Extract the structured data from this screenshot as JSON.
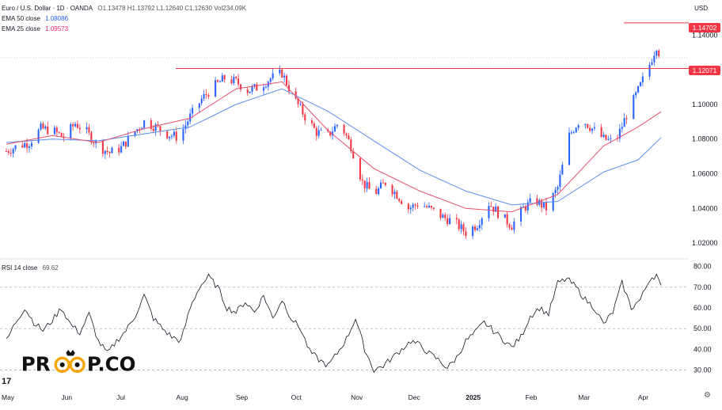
{
  "header": {
    "symbol_title": "Euro / U.S. Dollar · 1D · OANDA",
    "ohlc": "O1.13478 H1.13792 L1.12640 C1.12630 Vol234.09K",
    "ema50_label": "EMA 50 close",
    "ema50_value": "1.08086",
    "ema25_label": "EMA 25 close",
    "ema25_value": "1.09573",
    "currency": "USD"
  },
  "rsi_header": {
    "label": "RSI 14 close",
    "value": "69.62"
  },
  "price_labels": {
    "upper": "1.14702",
    "lower": "1.12071"
  },
  "logo": {
    "text_left": "PR",
    "text_right": "P.CO",
    "tv": "17"
  },
  "colors": {
    "up": "#2962ff",
    "down": "#f23645",
    "ema50": "#5b8def",
    "ema25": "#e8506b",
    "rsi": "#131722",
    "hline": "#f23645",
    "grid": "#d8d8d8"
  },
  "chart_data": [
    {
      "type": "candlestick",
      "title": "Euro / U.S. Dollar · 1D · OANDA",
      "x_ticks": [
        "May",
        "Jun",
        "Jul",
        "Aug",
        "Sep",
        "Oct",
        "Nov",
        "Dec",
        "2025",
        "Feb",
        "Mar",
        "Apr"
      ],
      "y_ticks": [
        "1.02000",
        "1.04000",
        "1.06000",
        "1.08000",
        "1.10000",
        "1.14000"
      ],
      "ylim": [
        1.015,
        1.152
      ],
      "horizontal_lines": [
        1.14702,
        1.12071
      ],
      "close_path": [
        [
          0,
          1.073
        ],
        [
          5,
          1.076
        ],
        [
          10,
          1.078
        ],
        [
          15,
          1.086
        ],
        [
          20,
          1.085
        ],
        [
          25,
          1.081
        ],
        [
          30,
          1.089
        ],
        [
          35,
          1.084
        ],
        [
          40,
          1.076
        ],
        [
          45,
          1.072
        ],
        [
          50,
          1.075
        ],
        [
          55,
          1.083
        ],
        [
          60,
          1.09
        ],
        [
          65,
          1.087
        ],
        [
          70,
          1.083
        ],
        [
          75,
          1.081
        ],
        [
          80,
          1.093
        ],
        [
          85,
          1.103
        ],
        [
          90,
          1.11
        ],
        [
          95,
          1.115
        ],
        [
          100,
          1.113
        ],
        [
          105,
          1.108
        ],
        [
          110,
          1.11
        ],
        [
          115,
          1.115
        ],
        [
          120,
          1.118
        ],
        [
          125,
          1.104
        ],
        [
          130,
          1.093
        ],
        [
          135,
          1.084
        ],
        [
          140,
          1.082
        ],
        [
          145,
          1.09
        ],
        [
          150,
          1.076
        ],
        [
          155,
          1.055
        ],
        [
          160,
          1.048
        ],
        [
          165,
          1.055
        ],
        [
          170,
          1.048
        ],
        [
          175,
          1.04
        ],
        [
          180,
          1.043
        ],
        [
          185,
          1.039
        ],
        [
          190,
          1.035
        ],
        [
          195,
          1.032
        ],
        [
          200,
          1.026
        ],
        [
          205,
          1.031
        ],
        [
          210,
          1.043
        ],
        [
          215,
          1.036
        ],
        [
          220,
          1.03
        ],
        [
          225,
          1.04
        ],
        [
          230,
          1.045
        ],
        [
          235,
          1.04
        ],
        [
          240,
          1.052
        ],
        [
          245,
          1.082
        ],
        [
          250,
          1.092
        ],
        [
          255,
          1.086
        ],
        [
          260,
          1.08
        ],
        [
          265,
          1.078
        ],
        [
          270,
          1.094
        ],
        [
          275,
          1.108
        ],
        [
          280,
          1.123
        ],
        [
          283,
          1.134
        ],
        [
          285,
          1.1263
        ]
      ],
      "ema50": [
        [
          0,
          1.078
        ],
        [
          20,
          1.08
        ],
        [
          40,
          1.079
        ],
        [
          60,
          1.083
        ],
        [
          80,
          1.087
        ],
        [
          100,
          1.1
        ],
        [
          120,
          1.109
        ],
        [
          140,
          1.096
        ],
        [
          160,
          1.079
        ],
        [
          180,
          1.062
        ],
        [
          200,
          1.05
        ],
        [
          220,
          1.042
        ],
        [
          240,
          1.044
        ],
        [
          260,
          1.061
        ],
        [
          275,
          1.068
        ],
        [
          285,
          1.08086
        ]
      ],
      "ema25": [
        [
          0,
          1.077
        ],
        [
          20,
          1.082
        ],
        [
          40,
          1.078
        ],
        [
          60,
          1.086
        ],
        [
          80,
          1.092
        ],
        [
          100,
          1.109
        ],
        [
          120,
          1.113
        ],
        [
          140,
          1.085
        ],
        [
          160,
          1.063
        ],
        [
          180,
          1.05
        ],
        [
          200,
          1.04
        ],
        [
          220,
          1.038
        ],
        [
          240,
          1.048
        ],
        [
          260,
          1.076
        ],
        [
          275,
          1.087
        ],
        [
          285,
          1.09573
        ]
      ]
    },
    {
      "type": "line",
      "title": "RSI 14 close",
      "y_ticks": [
        "30.00",
        "40.00",
        "50.00",
        "60.00",
        "70.00",
        "80.00"
      ],
      "ylim": [
        26,
        81
      ],
      "reference_lines": [
        70,
        50,
        30
      ],
      "series": [
        {
          "values": [
            [
              0,
              44
            ],
            [
              4,
              53
            ],
            [
              8,
              60
            ],
            [
              12,
              53
            ],
            [
              16,
              49
            ],
            [
              20,
              54
            ],
            [
              24,
              60
            ],
            [
              28,
              52
            ],
            [
              32,
              48
            ],
            [
              36,
              57
            ],
            [
              40,
              44
            ],
            [
              44,
              38
            ],
            [
              48,
              44
            ],
            [
              52,
              49
            ],
            [
              56,
              56
            ],
            [
              60,
              66
            ],
            [
              64,
              55
            ],
            [
              68,
              50
            ],
            [
              72,
              46
            ],
            [
              76,
              44
            ],
            [
              80,
              60
            ],
            [
              84,
              70
            ],
            [
              88,
              75
            ],
            [
              92,
              70
            ],
            [
              96,
              60
            ],
            [
              100,
              58
            ],
            [
              104,
              63
            ],
            [
              108,
              58
            ],
            [
              112,
              66
            ],
            [
              116,
              55
            ],
            [
              120,
              64
            ],
            [
              124,
              55
            ],
            [
              128,
              50
            ],
            [
              132,
              39
            ],
            [
              136,
              35
            ],
            [
              140,
              32
            ],
            [
              144,
              38
            ],
            [
              148,
              45
            ],
            [
              152,
              55
            ],
            [
              156,
              40
            ],
            [
              160,
              30
            ],
            [
              164,
              32
            ],
            [
              168,
              36
            ],
            [
              172,
              40
            ],
            [
              176,
              44
            ],
            [
              180,
              42
            ],
            [
              184,
              38
            ],
            [
              188,
              35
            ],
            [
              192,
              31
            ],
            [
              196,
              36
            ],
            [
              200,
              44
            ],
            [
              204,
              48
            ],
            [
              208,
              53
            ],
            [
              212,
              49
            ],
            [
              216,
              45
            ],
            [
              220,
              41
            ],
            [
              224,
              46
            ],
            [
              228,
              56
            ],
            [
              232,
              60
            ],
            [
              236,
              57
            ],
            [
              240,
              72
            ],
            [
              244,
              74
            ],
            [
              248,
              70
            ],
            [
              252,
              64
            ],
            [
              256,
              60
            ],
            [
              260,
              52
            ],
            [
              264,
              58
            ],
            [
              268,
              72
            ],
            [
              272,
              60
            ],
            [
              276,
              64
            ],
            [
              280,
              74
            ],
            [
              283,
              76
            ],
            [
              285,
              69.62
            ]
          ]
        }
      ]
    }
  ]
}
